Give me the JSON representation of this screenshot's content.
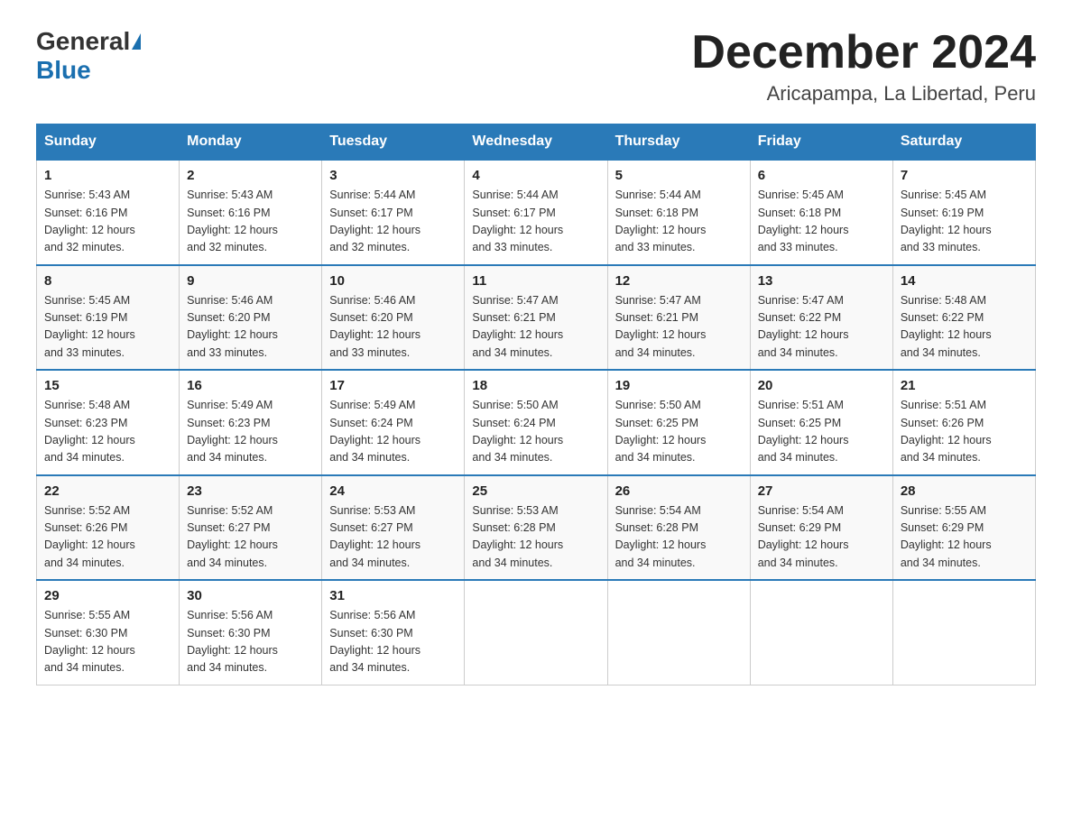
{
  "header": {
    "logo_text_general": "General",
    "logo_text_blue": "Blue",
    "month_title": "December 2024",
    "subtitle": "Aricapampa, La Libertad, Peru"
  },
  "days_of_week": [
    "Sunday",
    "Monday",
    "Tuesday",
    "Wednesday",
    "Thursday",
    "Friday",
    "Saturday"
  ],
  "weeks": [
    [
      {
        "day": "1",
        "sunrise": "5:43 AM",
        "sunset": "6:16 PM",
        "daylight": "12 hours and 32 minutes."
      },
      {
        "day": "2",
        "sunrise": "5:43 AM",
        "sunset": "6:16 PM",
        "daylight": "12 hours and 32 minutes."
      },
      {
        "day": "3",
        "sunrise": "5:44 AM",
        "sunset": "6:17 PM",
        "daylight": "12 hours and 32 minutes."
      },
      {
        "day": "4",
        "sunrise": "5:44 AM",
        "sunset": "6:17 PM",
        "daylight": "12 hours and 33 minutes."
      },
      {
        "day": "5",
        "sunrise": "5:44 AM",
        "sunset": "6:18 PM",
        "daylight": "12 hours and 33 minutes."
      },
      {
        "day": "6",
        "sunrise": "5:45 AM",
        "sunset": "6:18 PM",
        "daylight": "12 hours and 33 minutes."
      },
      {
        "day": "7",
        "sunrise": "5:45 AM",
        "sunset": "6:19 PM",
        "daylight": "12 hours and 33 minutes."
      }
    ],
    [
      {
        "day": "8",
        "sunrise": "5:45 AM",
        "sunset": "6:19 PM",
        "daylight": "12 hours and 33 minutes."
      },
      {
        "day": "9",
        "sunrise": "5:46 AM",
        "sunset": "6:20 PM",
        "daylight": "12 hours and 33 minutes."
      },
      {
        "day": "10",
        "sunrise": "5:46 AM",
        "sunset": "6:20 PM",
        "daylight": "12 hours and 33 minutes."
      },
      {
        "day": "11",
        "sunrise": "5:47 AM",
        "sunset": "6:21 PM",
        "daylight": "12 hours and 34 minutes."
      },
      {
        "day": "12",
        "sunrise": "5:47 AM",
        "sunset": "6:21 PM",
        "daylight": "12 hours and 34 minutes."
      },
      {
        "day": "13",
        "sunrise": "5:47 AM",
        "sunset": "6:22 PM",
        "daylight": "12 hours and 34 minutes."
      },
      {
        "day": "14",
        "sunrise": "5:48 AM",
        "sunset": "6:22 PM",
        "daylight": "12 hours and 34 minutes."
      }
    ],
    [
      {
        "day": "15",
        "sunrise": "5:48 AM",
        "sunset": "6:23 PM",
        "daylight": "12 hours and 34 minutes."
      },
      {
        "day": "16",
        "sunrise": "5:49 AM",
        "sunset": "6:23 PM",
        "daylight": "12 hours and 34 minutes."
      },
      {
        "day": "17",
        "sunrise": "5:49 AM",
        "sunset": "6:24 PM",
        "daylight": "12 hours and 34 minutes."
      },
      {
        "day": "18",
        "sunrise": "5:50 AM",
        "sunset": "6:24 PM",
        "daylight": "12 hours and 34 minutes."
      },
      {
        "day": "19",
        "sunrise": "5:50 AM",
        "sunset": "6:25 PM",
        "daylight": "12 hours and 34 minutes."
      },
      {
        "day": "20",
        "sunrise": "5:51 AM",
        "sunset": "6:25 PM",
        "daylight": "12 hours and 34 minutes."
      },
      {
        "day": "21",
        "sunrise": "5:51 AM",
        "sunset": "6:26 PM",
        "daylight": "12 hours and 34 minutes."
      }
    ],
    [
      {
        "day": "22",
        "sunrise": "5:52 AM",
        "sunset": "6:26 PM",
        "daylight": "12 hours and 34 minutes."
      },
      {
        "day": "23",
        "sunrise": "5:52 AM",
        "sunset": "6:27 PM",
        "daylight": "12 hours and 34 minutes."
      },
      {
        "day": "24",
        "sunrise": "5:53 AM",
        "sunset": "6:27 PM",
        "daylight": "12 hours and 34 minutes."
      },
      {
        "day": "25",
        "sunrise": "5:53 AM",
        "sunset": "6:28 PM",
        "daylight": "12 hours and 34 minutes."
      },
      {
        "day": "26",
        "sunrise": "5:54 AM",
        "sunset": "6:28 PM",
        "daylight": "12 hours and 34 minutes."
      },
      {
        "day": "27",
        "sunrise": "5:54 AM",
        "sunset": "6:29 PM",
        "daylight": "12 hours and 34 minutes."
      },
      {
        "day": "28",
        "sunrise": "5:55 AM",
        "sunset": "6:29 PM",
        "daylight": "12 hours and 34 minutes."
      }
    ],
    [
      {
        "day": "29",
        "sunrise": "5:55 AM",
        "sunset": "6:30 PM",
        "daylight": "12 hours and 34 minutes."
      },
      {
        "day": "30",
        "sunrise": "5:56 AM",
        "sunset": "6:30 PM",
        "daylight": "12 hours and 34 minutes."
      },
      {
        "day": "31",
        "sunrise": "5:56 AM",
        "sunset": "6:30 PM",
        "daylight": "12 hours and 34 minutes."
      },
      null,
      null,
      null,
      null
    ]
  ],
  "labels": {
    "sunrise": "Sunrise:",
    "sunset": "Sunset:",
    "daylight": "Daylight:"
  }
}
